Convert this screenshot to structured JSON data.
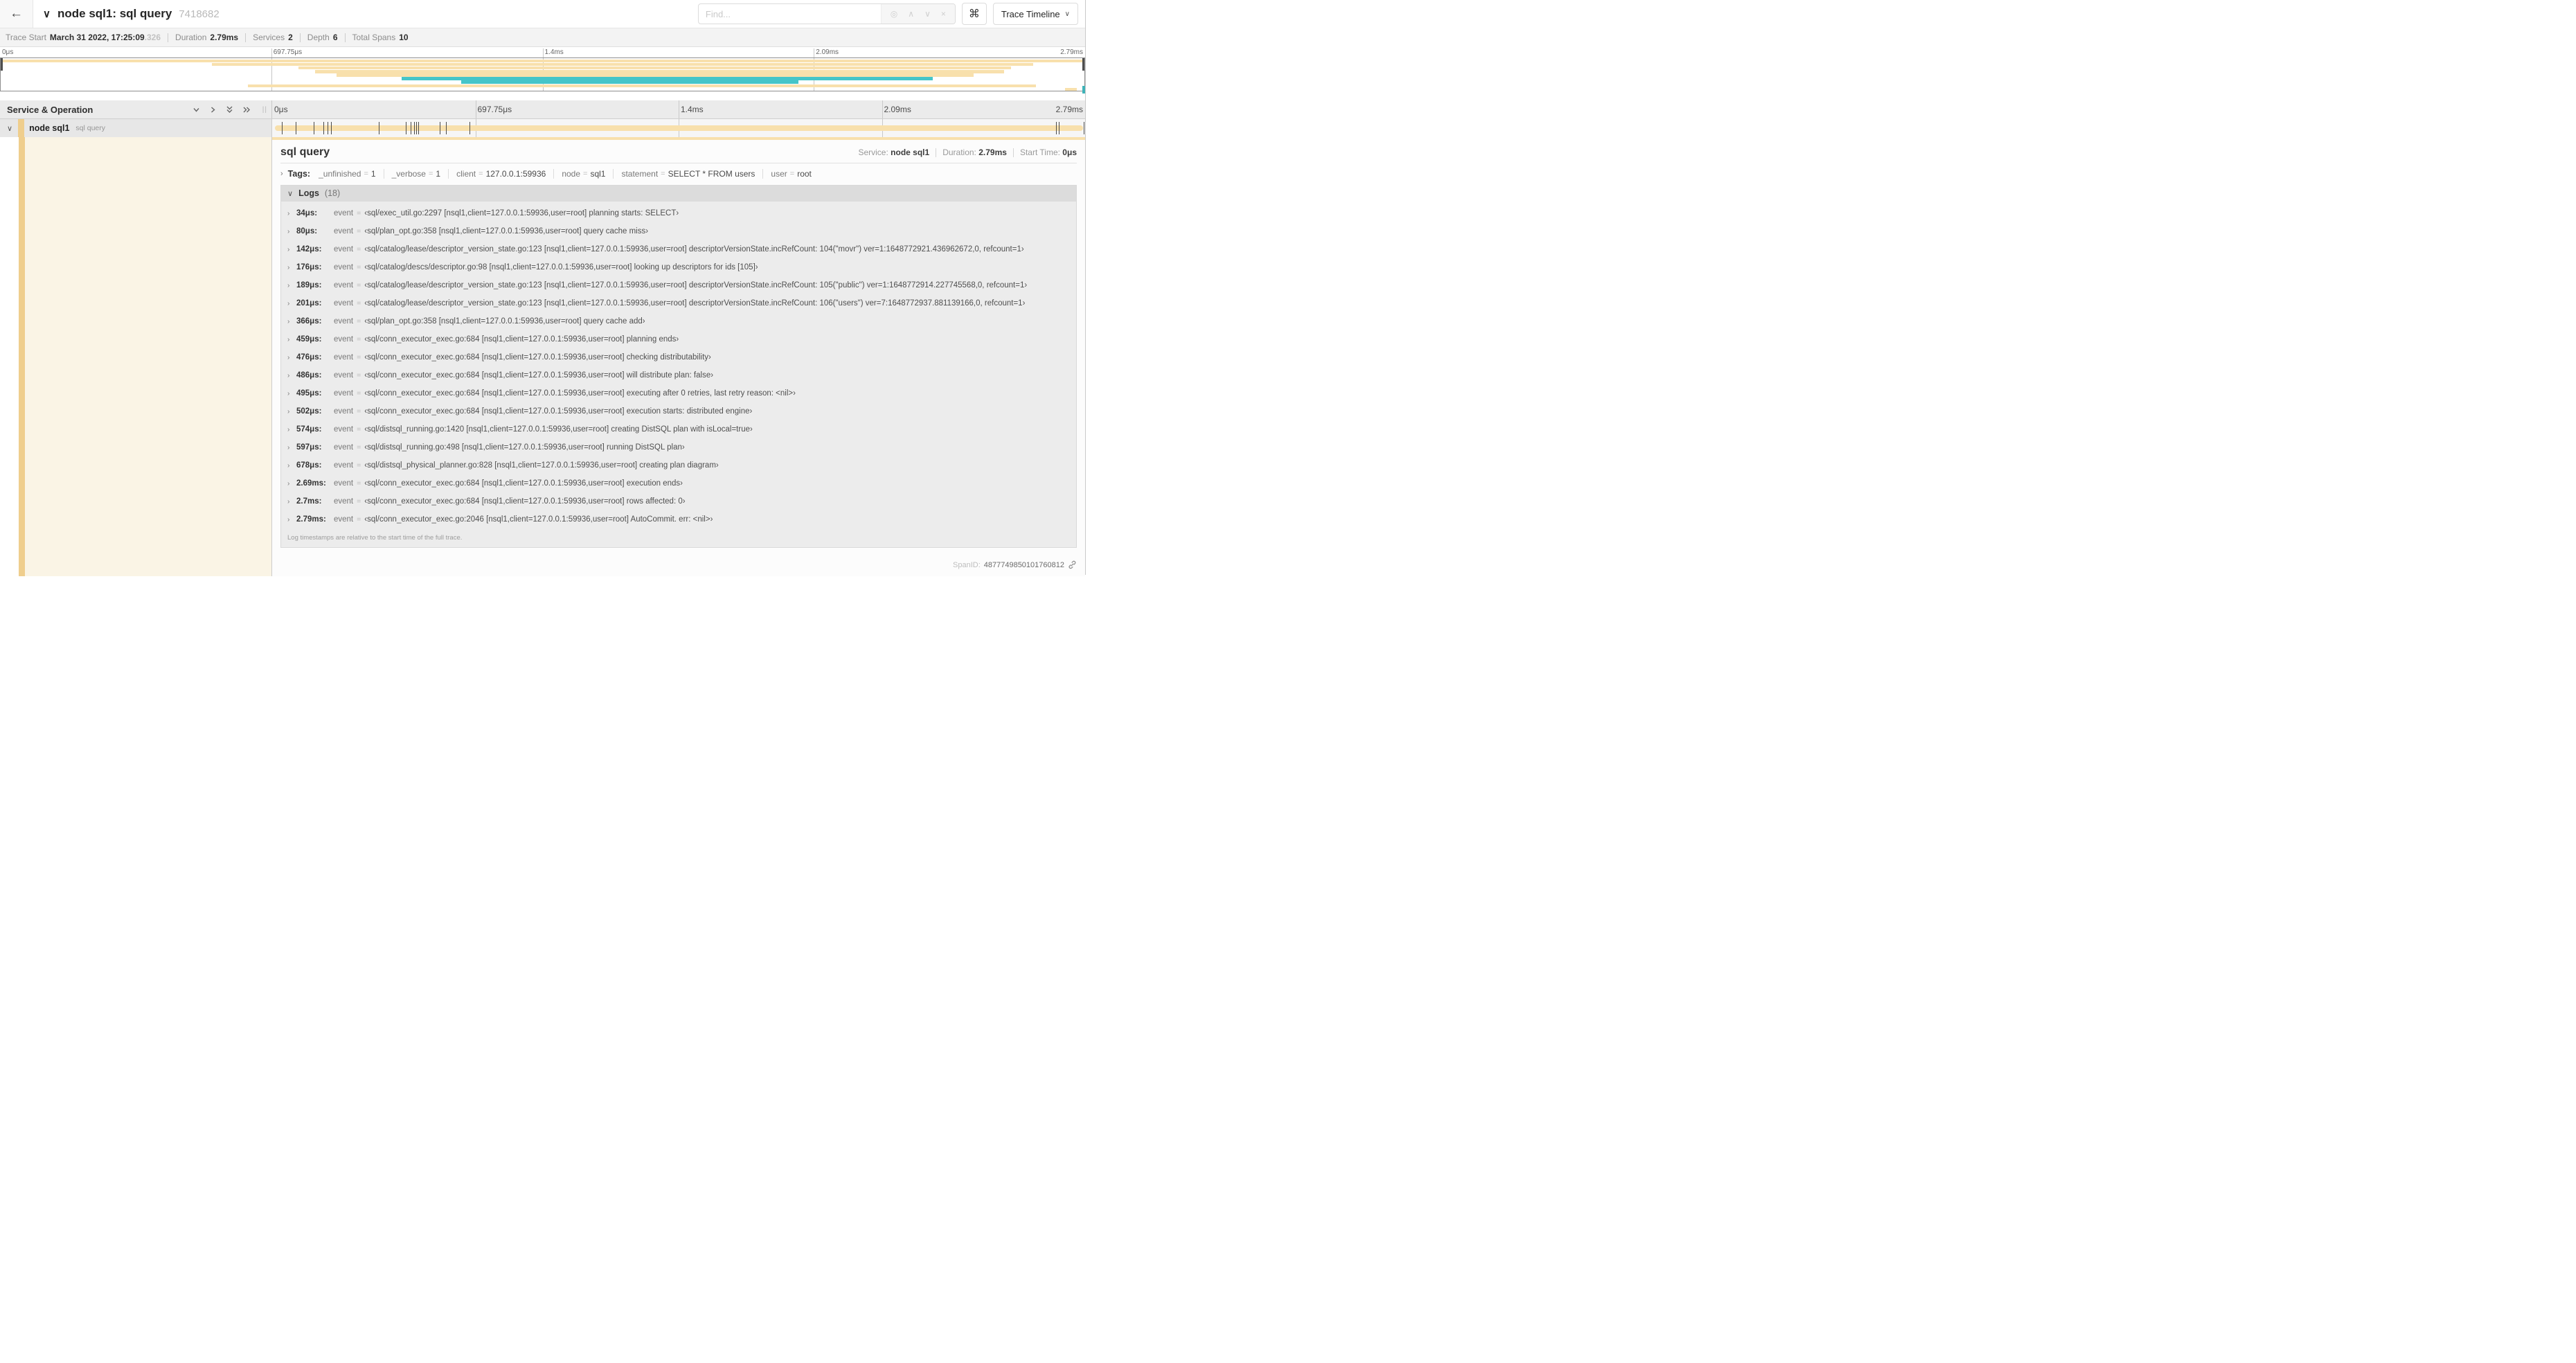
{
  "colors": {
    "tan": "#F8E0AC",
    "gold": "#EFCE8D",
    "teal": "#45C5C9",
    "cream": "#FAF4E5"
  },
  "icons": {
    "back": "←",
    "chevron_down": "∨",
    "chevron_right": "›",
    "target": "◎",
    "up": "∧",
    "down": "∨",
    "clear": "×",
    "command": "⌘",
    "resizer": "||"
  },
  "header": {
    "title": "node sql1: sql query",
    "trace_id": "7418682",
    "find_placeholder": "Find...",
    "view_selector": "Trace Timeline"
  },
  "summary": {
    "items": [
      {
        "label": "Trace Start",
        "value": "March 31 2022, 17:25:09",
        "suffix": ".326"
      },
      {
        "label": "Duration",
        "value": "2.79ms",
        "suffix": ""
      },
      {
        "label": "Services",
        "value": "2",
        "suffix": ""
      },
      {
        "label": "Depth",
        "value": "6",
        "suffix": ""
      },
      {
        "label": "Total Spans",
        "value": "10",
        "suffix": ""
      }
    ]
  },
  "timeline": {
    "column_header": "Service & Operation",
    "ticks": [
      {
        "label": "0μs",
        "pos": 0
      },
      {
        "label": "697.75μs",
        "pos": 25
      },
      {
        "label": "1.4ms",
        "pos": 50
      },
      {
        "label": "2.09ms",
        "pos": 75
      },
      {
        "label": "2.79ms",
        "pos": 100
      }
    ],
    "minimap_spans": [
      {
        "start": 0,
        "end": 100,
        "color": "tan"
      },
      {
        "start": 19.5,
        "end": 95.3,
        "color": "tan"
      },
      {
        "start": 27.5,
        "end": 93.2,
        "color": "tan"
      },
      {
        "start": 29,
        "end": 92.6,
        "color": "tan"
      },
      {
        "start": 31,
        "end": 89.8,
        "color": "tan"
      },
      {
        "start": 37,
        "end": 86,
        "color": "teal"
      },
      {
        "start": 42.5,
        "end": 73.6,
        "color": "teal"
      },
      {
        "start": 22.8,
        "end": 95.5,
        "color": "tan"
      },
      {
        "start": 98.2,
        "end": 99.3,
        "color": "tan"
      }
    ],
    "row": {
      "service": "node sql1",
      "operation": "sql query"
    },
    "total_us": 2790,
    "log_marks_us": [
      34,
      80,
      142,
      176,
      189,
      201,
      366,
      459,
      476,
      486,
      495,
      502,
      574,
      597,
      678,
      2690,
      2700,
      2790
    ]
  },
  "detail": {
    "title": "sql query",
    "service_label": "Service:",
    "service": "node sql1",
    "duration_label": "Duration:",
    "duration": "2.79ms",
    "start_time_label": "Start Time:",
    "start_time": "0μs",
    "tags_label": "Tags:",
    "tags": [
      {
        "key": "_unfinished",
        "value": "1"
      },
      {
        "key": "_verbose",
        "value": "1"
      },
      {
        "key": "client",
        "value": "127.0.0.1:59936"
      },
      {
        "key": "node",
        "value": "sql1"
      },
      {
        "key": "statement",
        "value": "SELECT * FROM users"
      },
      {
        "key": "user",
        "value": "root"
      }
    ],
    "logs_label": "Logs",
    "logs_count": "(18)",
    "log_field": "event",
    "logs": [
      {
        "time": "34μs:",
        "value": "‹sql/exec_util.go:2297 [nsql1,client=127.0.0.1:59936,user=root] planning starts: SELECT›"
      },
      {
        "time": "80μs:",
        "value": "‹sql/plan_opt.go:358 [nsql1,client=127.0.0.1:59936,user=root] query cache miss›"
      },
      {
        "time": "142μs:",
        "value": "‹sql/catalog/lease/descriptor_version_state.go:123 [nsql1,client=127.0.0.1:59936,user=root] descriptorVersionState.incRefCount: 104(\"movr\") ver=1:1648772921.436962672,0, refcount=1›"
      },
      {
        "time": "176μs:",
        "value": "‹sql/catalog/descs/descriptor.go:98 [nsql1,client=127.0.0.1:59936,user=root] looking up descriptors for ids [105]›"
      },
      {
        "time": "189μs:",
        "value": "‹sql/catalog/lease/descriptor_version_state.go:123 [nsql1,client=127.0.0.1:59936,user=root] descriptorVersionState.incRefCount: 105(\"public\") ver=1:1648772914.227745568,0, refcount=1›"
      },
      {
        "time": "201μs:",
        "value": "‹sql/catalog/lease/descriptor_version_state.go:123 [nsql1,client=127.0.0.1:59936,user=root] descriptorVersionState.incRefCount: 106(\"users\") ver=7:1648772937.881139166,0, refcount=1›"
      },
      {
        "time": "366μs:",
        "value": "‹sql/plan_opt.go:358 [nsql1,client=127.0.0.1:59936,user=root] query cache add›"
      },
      {
        "time": "459μs:",
        "value": "‹sql/conn_executor_exec.go:684 [nsql1,client=127.0.0.1:59936,user=root] planning ends›"
      },
      {
        "time": "476μs:",
        "value": "‹sql/conn_executor_exec.go:684 [nsql1,client=127.0.0.1:59936,user=root] checking distributability›"
      },
      {
        "time": "486μs:",
        "value": "‹sql/conn_executor_exec.go:684 [nsql1,client=127.0.0.1:59936,user=root] will distribute plan: false›"
      },
      {
        "time": "495μs:",
        "value": "‹sql/conn_executor_exec.go:684 [nsql1,client=127.0.0.1:59936,user=root] executing after 0 retries, last retry reason: <nil>›"
      },
      {
        "time": "502μs:",
        "value": "‹sql/conn_executor_exec.go:684 [nsql1,client=127.0.0.1:59936,user=root] execution starts: distributed engine›"
      },
      {
        "time": "574μs:",
        "value": "‹sql/distsql_running.go:1420 [nsql1,client=127.0.0.1:59936,user=root] creating DistSQL plan with isLocal=true›"
      },
      {
        "time": "597μs:",
        "value": "‹sql/distsql_running.go:498 [nsql1,client=127.0.0.1:59936,user=root] running DistSQL plan›"
      },
      {
        "time": "678μs:",
        "value": "‹sql/distsql_physical_planner.go:828 [nsql1,client=127.0.0.1:59936,user=root] creating plan diagram›"
      },
      {
        "time": "2.69ms:",
        "value": "‹sql/conn_executor_exec.go:684 [nsql1,client=127.0.0.1:59936,user=root] execution ends›"
      },
      {
        "time": "2.7ms:",
        "value": "‹sql/conn_executor_exec.go:684 [nsql1,client=127.0.0.1:59936,user=root] rows affected: 0›"
      },
      {
        "time": "2.79ms:",
        "value": "‹sql/conn_executor_exec.go:2046 [nsql1,client=127.0.0.1:59936,user=root] AutoCommit. err: <nil>›"
      }
    ],
    "footnote": "Log timestamps are relative to the start time of the full trace.",
    "span_id_label": "SpanID:",
    "span_id": "4877749850101760812"
  }
}
